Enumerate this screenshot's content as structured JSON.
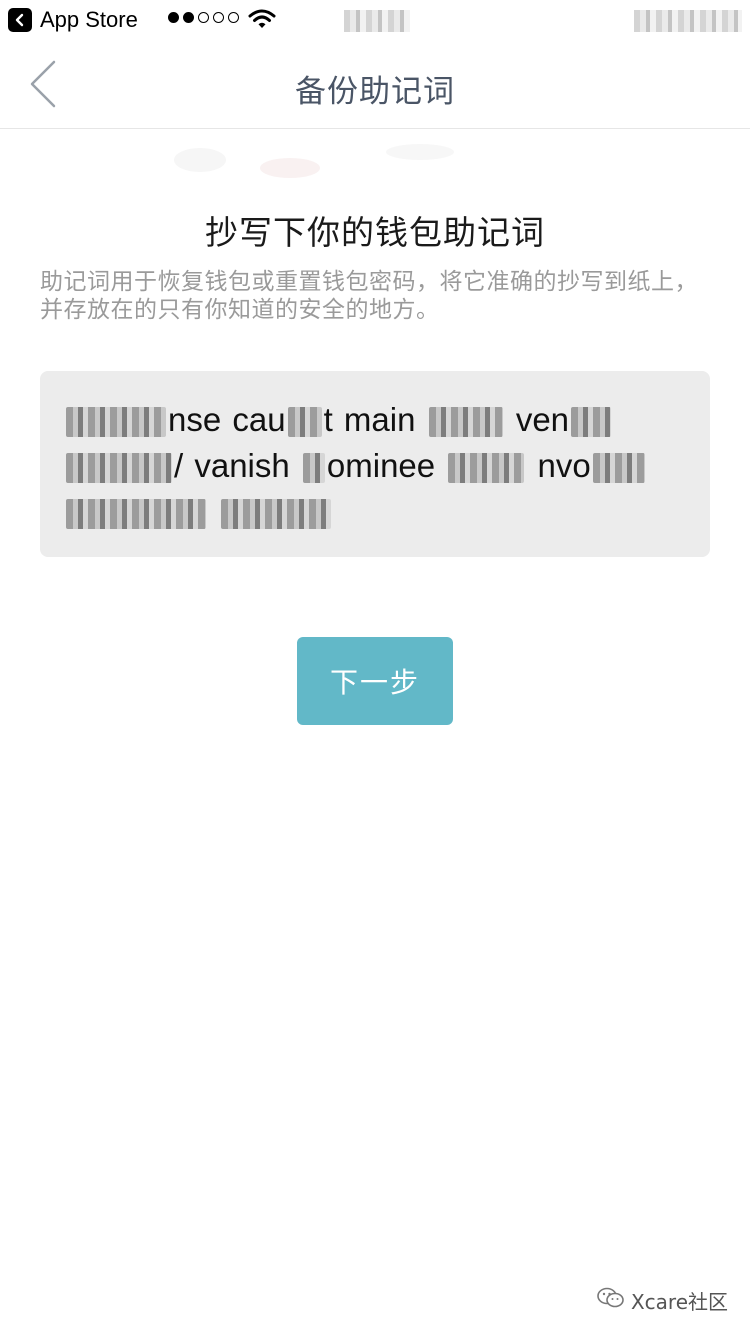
{
  "status_bar": {
    "back_app_label": "App Store",
    "signal_dots": 5,
    "signal_filled": 2,
    "icons": [
      "back-arrow-icon",
      "wifi-icon"
    ]
  },
  "nav": {
    "title": "备份助记词",
    "back_icon": "chevron-left-icon"
  },
  "content": {
    "heading": "抄写下你的钱包助记词",
    "description": "助记词用于恢复钱包或重置钱包密码，将它准确的抄写到纸上，并存放在的只有你知道的安全的地方。",
    "phrase_words": [
      "nse cau",
      "t main",
      "ven",
      "/ vanish",
      "ominee",
      "nvo"
    ],
    "next_button_label": "下一步"
  },
  "watermark": {
    "text": "Xcare社区"
  },
  "colors": {
    "accent": "#62b8c8",
    "nav_title": "#4a5566",
    "description": "#9a9a9a",
    "phrase_bg": "#ececec"
  }
}
